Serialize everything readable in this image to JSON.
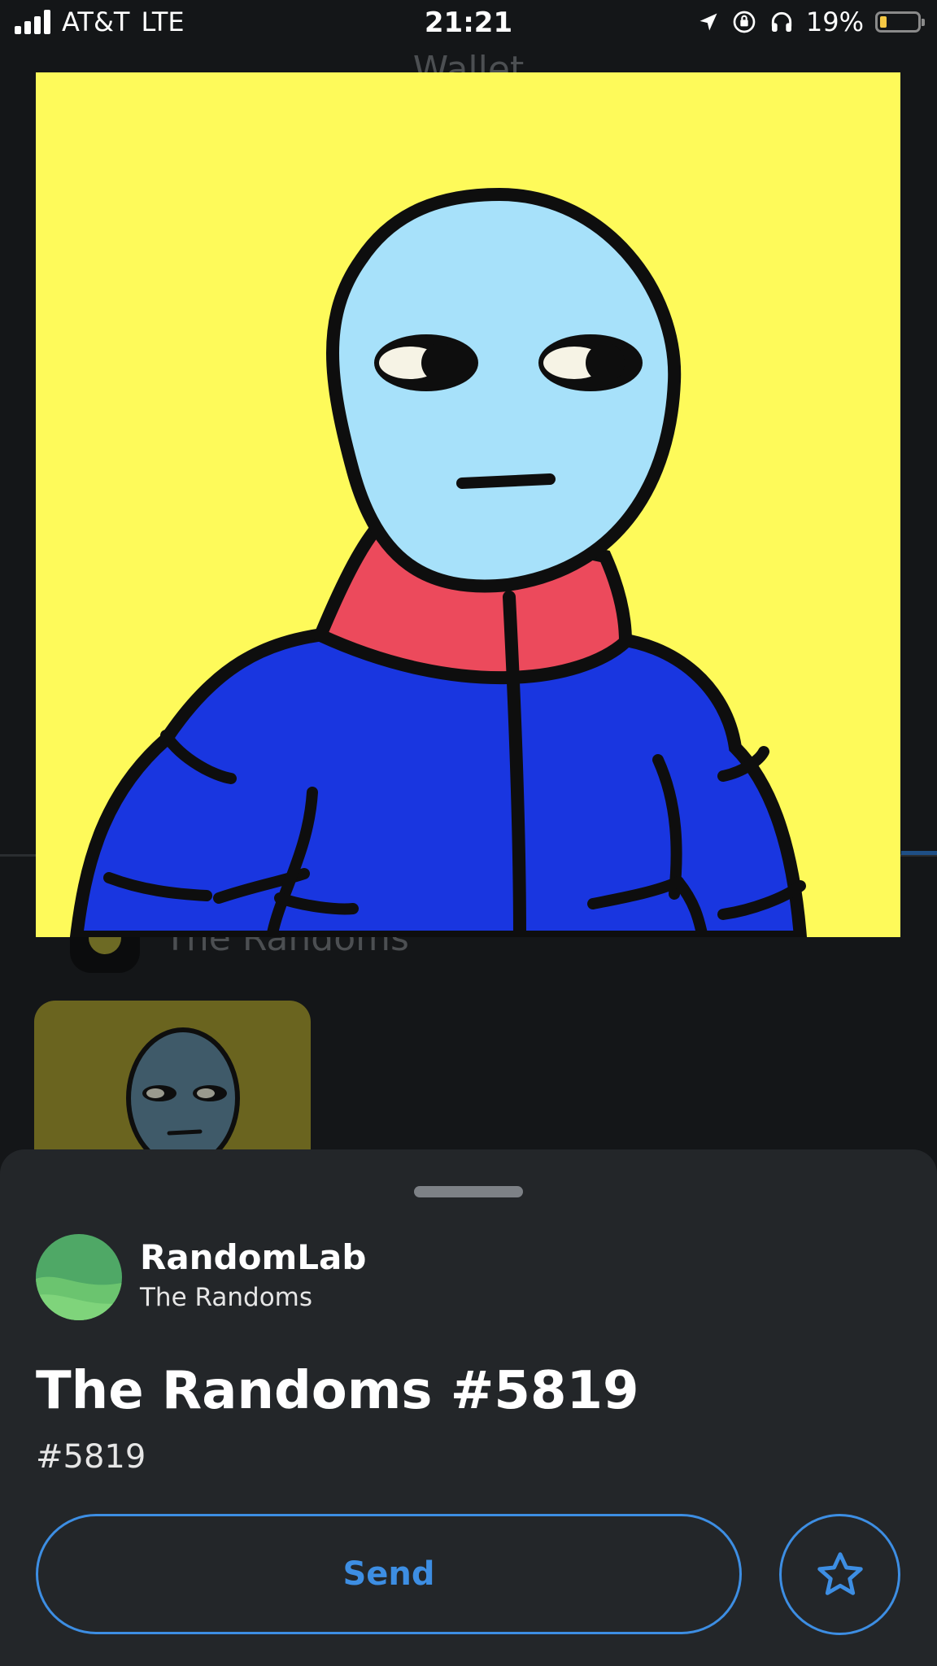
{
  "status_bar": {
    "carrier": "AT&T",
    "network": "LTE",
    "time": "21:21",
    "battery": "19%",
    "battery_level": 0.19
  },
  "background_screen": {
    "title": "Wallet",
    "collection_name": "The Randoms"
  },
  "nft_image": {
    "background_color": "#fefa5a"
  },
  "sheet": {
    "creator_name": "RandomLab",
    "collection_name": "The Randoms",
    "title": "The Randoms #5819",
    "token_id": "#5819",
    "send_label": "Send",
    "accent_color": "#3d8ee3"
  }
}
